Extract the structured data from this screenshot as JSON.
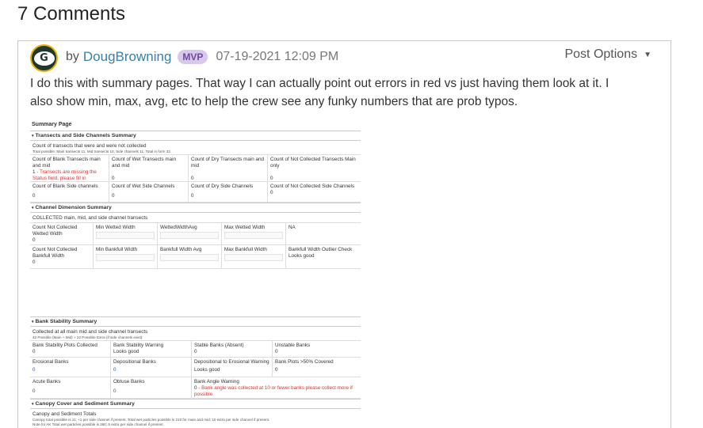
{
  "heading": "7 Comments",
  "post": {
    "by": "by",
    "author": "DougBrowning",
    "badge": "MVP",
    "date": "07-19-2021 12:09 PM",
    "options": "Post Options",
    "body_line1": "I do this with summary pages.  That way I can actually point out errors in red vs just having them look at it.  I",
    "body_line2": "also show min, max, avg, etc to help the crew see any funky numbers that are prob typos."
  },
  "shot1": {
    "page_title": "Summary Page",
    "sec1": "Transects and Side Channels Summary",
    "sub1_title": "Count of transects that were and were not collected",
    "sub1_note": "Total possible: Main transects 11, Mid transects 10, Side channels 11. Total in form 32.",
    "r1": [
      {
        "label": "Count of Blank Transects main and mid",
        "val": "1",
        "err": " - Transects are missing the Status field, please fill in"
      },
      {
        "label": "Count of Wet Transects main and mid",
        "val": "0"
      },
      {
        "label": "Count of Dry Transects main and mid",
        "val": "0"
      },
      {
        "label": "Count of Not Collected Transects Main only",
        "val": "0"
      }
    ],
    "r2": [
      {
        "label": "Count of Blank Side channels",
        "val": "0"
      },
      {
        "label": "Count of Wet Side Channels",
        "val": "0"
      },
      {
        "label": "Count of Dry Side Channels",
        "val": "0"
      },
      {
        "label": "Count of Not Collected Side Channels",
        "val": "0"
      }
    ],
    "sec2": "Channel Dimension Summary",
    "sub2_title": "COLLECTED main, mid, and side channel transects",
    "r3": [
      {
        "label": "Count Not Collected Wetted Width",
        "val": "0"
      },
      {
        "label": "Min Wetted Width"
      },
      {
        "label": "WettedWidthAvg"
      },
      {
        "label": "Max Wetted Width"
      },
      {
        "label": "NA"
      }
    ],
    "r4": [
      {
        "label": "Count Not Collected Bankfull Width",
        "val": "0"
      },
      {
        "label": "Min Bankfull Width"
      },
      {
        "label": "Bankfull Width Avg"
      },
      {
        "label": "Max Bankfull Width"
      },
      {
        "label": "Bankfull Width Outlier Check",
        "val": "Looks good"
      }
    ]
  },
  "shot2": {
    "sec1": "Bank Stability Summary",
    "sub1_title": "Collected at all main mid and side channel transects",
    "sub1_note": "42 Possible (Main + Mid) + 22 Possible Extra (if side channels exist)",
    "r1": [
      {
        "label": "Bank Stability Plots Collected",
        "val": "0"
      },
      {
        "label": "Bank Stability Warning",
        "val": "Looks good"
      },
      {
        "label": "Stable Banks (Absent)",
        "val": "0"
      },
      {
        "label": "Unstable Banks",
        "val": "0"
      }
    ],
    "r2": [
      {
        "label": "Erosional Banks",
        "val": "0"
      },
      {
        "label": "Depositional Banks",
        "val": "0"
      },
      {
        "label": "Depositional to Erosional Warning",
        "val": "Looks good"
      },
      {
        "label": "Bank Plots >50% Covered",
        "val": "0"
      }
    ],
    "r3": [
      {
        "label": "Acute Banks",
        "val": "0"
      },
      {
        "label": "Obtuse Banks",
        "val": "0"
      },
      {
        "label": "Bank Angle Warning",
        "val": "0",
        "err": " - Bank angle was collected at 10 or fewer banks please collect more if possible."
      }
    ],
    "sec2": "Canopy Cover and Sediment Summary",
    "sub2_title": "Canopy and Sediment Totals",
    "sub2_note": "Canopy total possible is 11; +1 per side channel if present. Total wet particles possible is 210 for main and mid; 10 extra per side channel if present.",
    "sub2_note2": "Note for AK Total wet particles possible is 260; 5 extra per side channel if present."
  },
  "colors": {
    "author": "#3a7fa8",
    "badge_bg": "#d8c9ec",
    "badge_text": "#6c4b9a",
    "error": "#e03030",
    "value_blue": "#1a4fd0"
  }
}
